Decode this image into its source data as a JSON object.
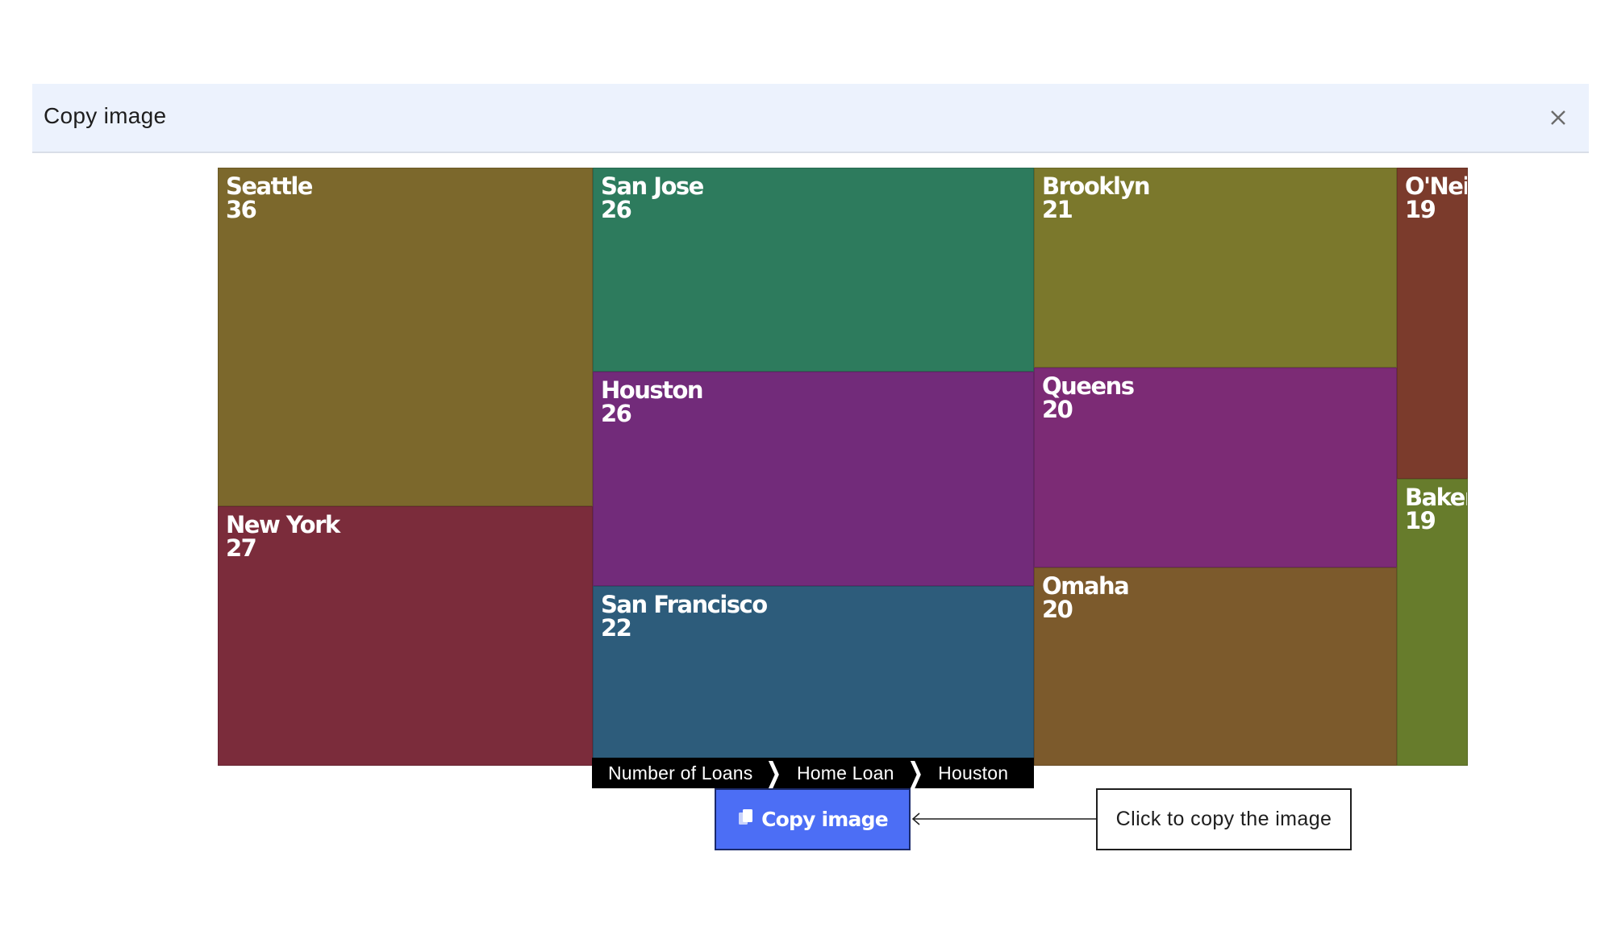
{
  "dialog": {
    "title": "Copy image",
    "close_icon": "close-icon"
  },
  "treemap": {
    "tiles": [
      {
        "label": "Seattle",
        "value": "36",
        "color": "#7c682c"
      },
      {
        "label": "New York",
        "value": "27",
        "color": "#7b2c3b"
      },
      {
        "label": "San Jose",
        "value": "26",
        "color": "#2d7b5d"
      },
      {
        "label": "Houston",
        "value": "26",
        "color": "#722b7a"
      },
      {
        "label": "San Francisco",
        "value": "22",
        "color": "#2d5c7b"
      },
      {
        "label": "Brooklyn",
        "value": "21",
        "color": "#7b782c"
      },
      {
        "label": "Queens",
        "value": "20",
        "color": "#7c2b75"
      },
      {
        "label": "Omaha",
        "value": "20",
        "color": "#7c5a2c"
      },
      {
        "label": "O'Neil",
        "value": "19",
        "color": "#7b3b2c"
      },
      {
        "label": "Baker",
        "value": "19",
        "color": "#677c2c"
      }
    ]
  },
  "breadcrumb": {
    "items": [
      "Number of Loans",
      "Home Loan",
      "Houston"
    ]
  },
  "copy_button": {
    "label": "Copy image",
    "icon": "copy-icon",
    "color": "#4c6ef5"
  },
  "callout": {
    "text": "Click to copy the image"
  }
}
